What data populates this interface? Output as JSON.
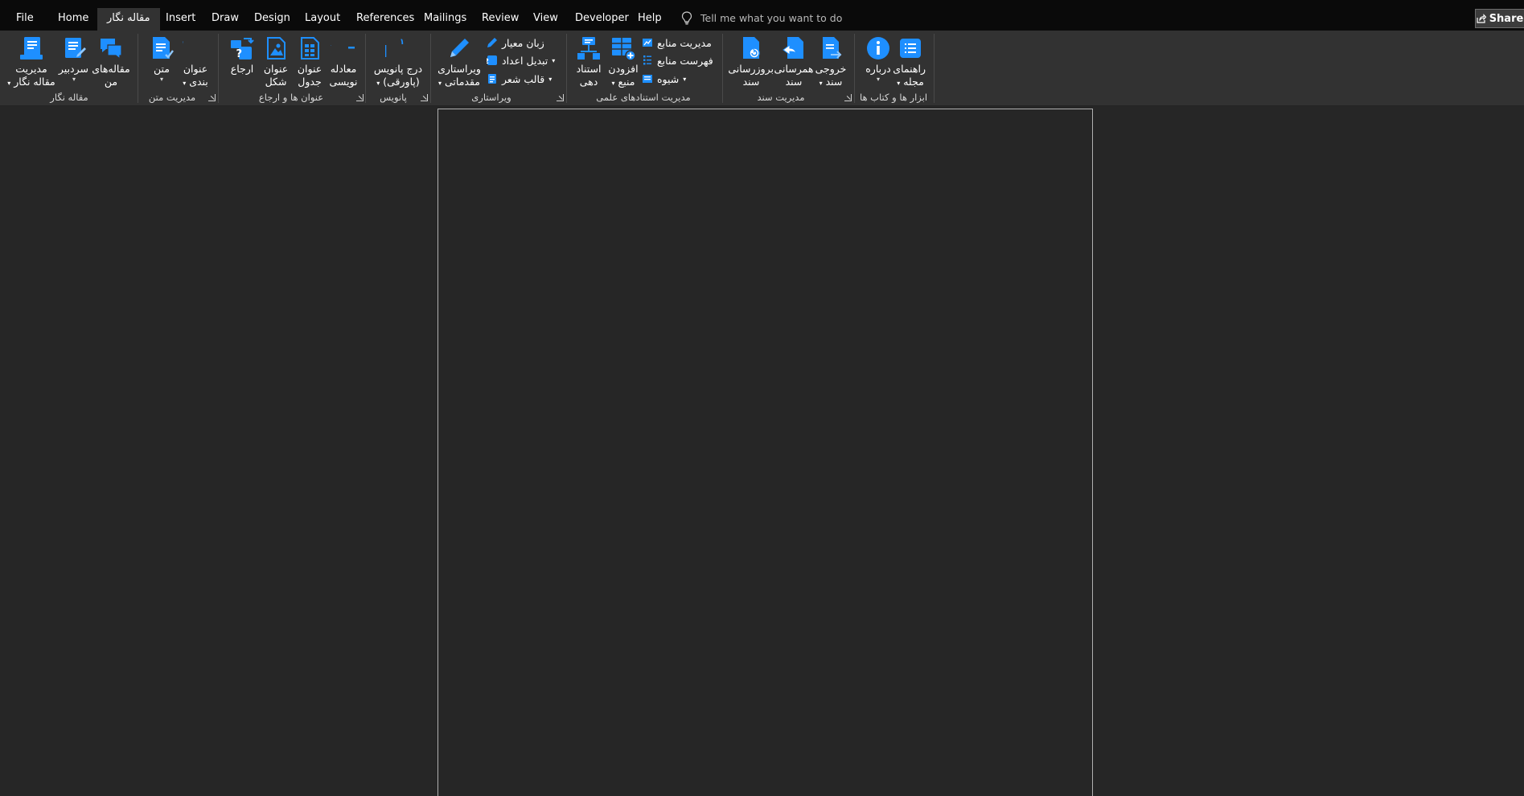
{
  "tabs": [
    {
      "key": "file",
      "label": "File"
    },
    {
      "key": "home",
      "label": "Home"
    },
    {
      "key": "maghale",
      "label": "مقاله نگار"
    },
    {
      "key": "insert",
      "label": "Insert"
    },
    {
      "key": "draw",
      "label": "Draw"
    },
    {
      "key": "design",
      "label": "Design"
    },
    {
      "key": "layout",
      "label": "Layout"
    },
    {
      "key": "references",
      "label": "References"
    },
    {
      "key": "mailings",
      "label": "Mailings"
    },
    {
      "key": "review",
      "label": "Review"
    },
    {
      "key": "view",
      "label": "View"
    },
    {
      "key": "developer",
      "label": "Developer"
    },
    {
      "key": "help",
      "label": "Help"
    }
  ],
  "active_tab": "مقاله نگار",
  "tell_me": {
    "placeholder": "Tell me what you want to do",
    "icon": "lightbulb-icon"
  },
  "share": {
    "label": "Share",
    "icon": "share-icon"
  },
  "ribbon": {
    "groups": {
      "maghale_negar": {
        "label": "مقاله نگار",
        "manage": {
          "line1": "مدیریت",
          "line2": "مقاله نگار",
          "icon": "manage-article-icon"
        },
        "sardabir": {
          "line1": "سردبیر",
          "icon": "editor-in-chief-icon"
        },
        "my_articles": {
          "line1": "مقاله‌های",
          "line2": "من",
          "icon": "my-articles-icon"
        }
      },
      "text_management": {
        "label": "مدیریت متن",
        "matn": {
          "line1": "متن",
          "icon": "text-doc-icon"
        },
        "heading": {
          "line1": "عنوان",
          "line2": "بندی",
          "icon": "heading-icon"
        }
      },
      "captions": {
        "label": "عنوان ها و ارجاع",
        "reference": {
          "line1": "ارجاع",
          "icon": "cross-reference-icon"
        },
        "figure": {
          "line1": "عنوان",
          "line2": "شکل",
          "icon": "figure-caption-icon"
        },
        "table": {
          "line1": "عنوان",
          "line2": "جدول",
          "icon": "table-caption-icon"
        },
        "equation": {
          "line1": "معادله",
          "line2": "نویسی",
          "icon": "equation-icon"
        }
      },
      "footnote": {
        "label": "پانویس",
        "insert": {
          "line1": "درج پانویس",
          "line2": "(پاورقی)",
          "icon": "footnote-icon"
        }
      },
      "editing": {
        "label": "ویراستاری",
        "pre_edit": {
          "line1": "ویراستاری",
          "line2": "مقدماتی",
          "icon": "pencil-icon"
        },
        "standard_lang": "زبان معیار",
        "convert_numbers": "تبدیل اعداد",
        "poem_format": "قالب شعر"
      },
      "citations": {
        "label": "مدیریت استنادهای علمی",
        "cite": {
          "line1": "استناد",
          "line2": "دهی",
          "icon": "cite-icon"
        },
        "add_source": {
          "line1": "افزودن",
          "line2": "منبع",
          "icon": "add-source-icon"
        },
        "manage_sources": "مدیریت منابع",
        "bibliography": "فهرست منابع",
        "style": "شیوه"
      },
      "document": {
        "label": "مدیریت سند",
        "update": {
          "line1": "بروزرسانی",
          "line2": "سند",
          "icon": "update-doc-icon"
        },
        "sync": {
          "line1": "همرسانی",
          "line2": "سند",
          "icon": "sync-doc-icon"
        },
        "export": {
          "line1": "خروجی",
          "line2": "سند",
          "icon": "export-doc-icon"
        }
      },
      "tools": {
        "label": "ابزار ها و کتاب ها",
        "about": {
          "line1": "درباره",
          "icon": "info-icon"
        },
        "journal_guide": {
          "line1": "راهنمای",
          "line2": "مجله",
          "icon": "journal-guide-icon"
        }
      }
    }
  },
  "colors": {
    "accent": "#1e8fff",
    "menubar": "#0a0a0a",
    "ribbon": "#323232",
    "canvas": "#262626"
  }
}
